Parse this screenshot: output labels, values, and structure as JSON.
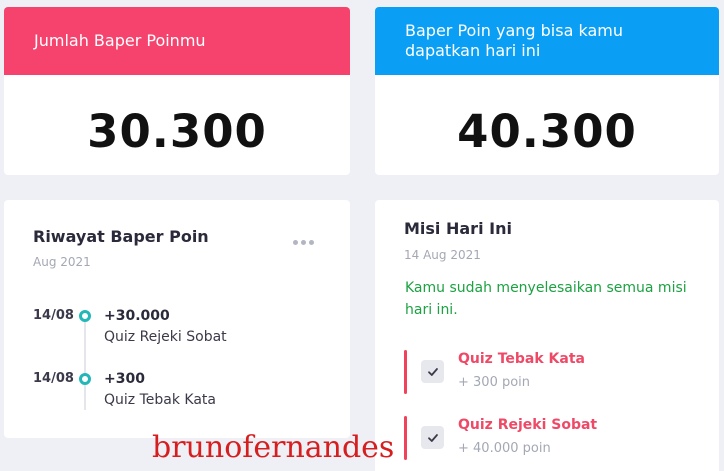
{
  "points_card": {
    "title": "Jumlah Baper Poinmu",
    "value": "30.300",
    "header_color": "#f5436e"
  },
  "available_card": {
    "title": "Baper Poin yang bisa kamu dapatkan hari ini",
    "value": "40.300",
    "header_color": "#0a9ff5"
  },
  "history": {
    "title": "Riwayat Baper Poin",
    "period": "Aug 2021",
    "more_icon": "more-horizontal-icon",
    "items": [
      {
        "date": "14/08",
        "amount": "+30.000",
        "desc": "Quiz Rejeki Sobat"
      },
      {
        "date": "14/08",
        "amount": "+300",
        "desc": "Quiz Tebak Kata"
      }
    ]
  },
  "mission": {
    "title": "Misi Hari Ini",
    "date": "14 Aug 2021",
    "completed_message": "Kamu sudah menyelesaikan semua misi hari ini.",
    "items": [
      {
        "name": "Quiz Tebak Kata",
        "points": "+ 300 poin",
        "done": true
      },
      {
        "name": "Quiz Rejeki Sobat",
        "points": "+ 40.000 poin",
        "done": true
      }
    ]
  },
  "watermark": "brunofernandes"
}
